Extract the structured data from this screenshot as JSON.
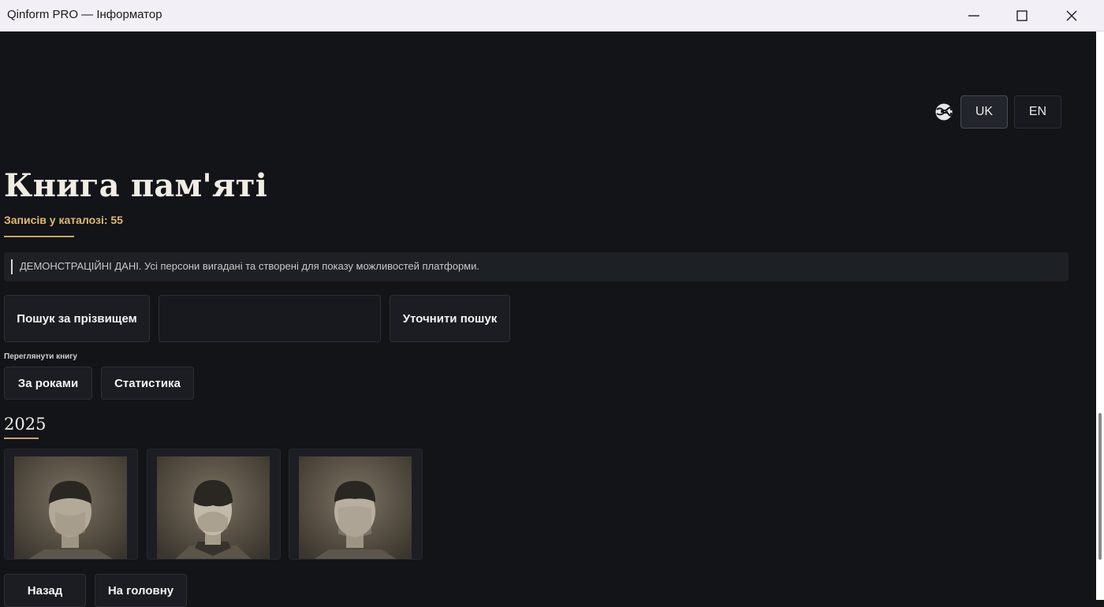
{
  "window": {
    "title": "Qinform PRO — Інформатор"
  },
  "language": {
    "options": [
      "UK",
      "EN"
    ],
    "active": "UK"
  },
  "page": {
    "title": "Книга пам'яті",
    "count_label": "Записів у каталозі: 55"
  },
  "notice": {
    "text": "ДЕМОНСТРАЦІЙНІ ДАНІ. Усі персони вигадані та створені для показу можливостей платформи."
  },
  "search": {
    "mode_button": "Пошук за прізвищем",
    "input_value": "",
    "input_placeholder": "",
    "refine_button": "Уточнити пошук"
  },
  "browse": {
    "label": "Переглянути книгу",
    "by_years": "За роками",
    "statistics": "Статистика"
  },
  "year_section": {
    "year": "2025",
    "cards": [
      {
        "photo": "person-silhouette"
      },
      {
        "photo": "person-silhouette"
      },
      {
        "photo": "person-silhouette"
      }
    ]
  },
  "footer_nav": {
    "back": "Назад",
    "home": "На головну"
  },
  "colors": {
    "background": "#121418",
    "accent_gold": "#e2b96f",
    "title_text": "#f1ece4"
  }
}
